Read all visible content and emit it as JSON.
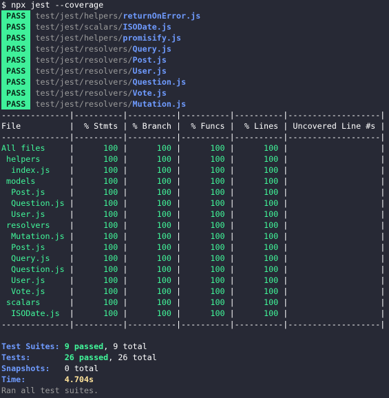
{
  "command": "$ npx jest --coverage",
  "results": [
    {
      "status": "PASS",
      "dir": "test/jest/helpers/",
      "file": "returnOnError.js"
    },
    {
      "status": "PASS",
      "dir": "test/jest/scalars/",
      "file": "ISODate.js"
    },
    {
      "status": "PASS",
      "dir": "test/jest/helpers/",
      "file": "promisify.js"
    },
    {
      "status": "PASS",
      "dir": "test/jest/resolvers/",
      "file": "Query.js"
    },
    {
      "status": "PASS",
      "dir": "test/jest/resolvers/",
      "file": "Post.js"
    },
    {
      "status": "PASS",
      "dir": "test/jest/resolvers/",
      "file": "User.js"
    },
    {
      "status": "PASS",
      "dir": "test/jest/resolvers/",
      "file": "Question.js"
    },
    {
      "status": "PASS",
      "dir": "test/jest/resolvers/",
      "file": "Vote.js"
    },
    {
      "status": "PASS",
      "dir": "test/jest/resolvers/",
      "file": "Mutation.js"
    }
  ],
  "coverage": {
    "headers": [
      "File",
      "% Stmts",
      "% Branch",
      "% Funcs",
      "% Lines",
      "Uncovered Line #s"
    ],
    "rows": [
      {
        "file": "All files",
        "indent": 0,
        "stmts": "100",
        "branch": "100",
        "funcs": "100",
        "lines": "100",
        "uncovered": ""
      },
      {
        "file": "helpers",
        "indent": 1,
        "stmts": "100",
        "branch": "100",
        "funcs": "100",
        "lines": "100",
        "uncovered": ""
      },
      {
        "file": "index.js",
        "indent": 2,
        "stmts": "100",
        "branch": "100",
        "funcs": "100",
        "lines": "100",
        "uncovered": ""
      },
      {
        "file": "models",
        "indent": 1,
        "stmts": "100",
        "branch": "100",
        "funcs": "100",
        "lines": "100",
        "uncovered": ""
      },
      {
        "file": "Post.js",
        "indent": 2,
        "stmts": "100",
        "branch": "100",
        "funcs": "100",
        "lines": "100",
        "uncovered": ""
      },
      {
        "file": "Question.js",
        "indent": 2,
        "stmts": "100",
        "branch": "100",
        "funcs": "100",
        "lines": "100",
        "uncovered": ""
      },
      {
        "file": "User.js",
        "indent": 2,
        "stmts": "100",
        "branch": "100",
        "funcs": "100",
        "lines": "100",
        "uncovered": ""
      },
      {
        "file": "resolvers",
        "indent": 1,
        "stmts": "100",
        "branch": "100",
        "funcs": "100",
        "lines": "100",
        "uncovered": ""
      },
      {
        "file": "Mutation.js",
        "indent": 2,
        "stmts": "100",
        "branch": "100",
        "funcs": "100",
        "lines": "100",
        "uncovered": ""
      },
      {
        "file": "Post.js",
        "indent": 2,
        "stmts": "100",
        "branch": "100",
        "funcs": "100",
        "lines": "100",
        "uncovered": ""
      },
      {
        "file": "Query.js",
        "indent": 2,
        "stmts": "100",
        "branch": "100",
        "funcs": "100",
        "lines": "100",
        "uncovered": ""
      },
      {
        "file": "Question.js",
        "indent": 2,
        "stmts": "100",
        "branch": "100",
        "funcs": "100",
        "lines": "100",
        "uncovered": ""
      },
      {
        "file": "User.js",
        "indent": 2,
        "stmts": "100",
        "branch": "100",
        "funcs": "100",
        "lines": "100",
        "uncovered": ""
      },
      {
        "file": "Vote.js",
        "indent": 2,
        "stmts": "100",
        "branch": "100",
        "funcs": "100",
        "lines": "100",
        "uncovered": ""
      },
      {
        "file": "scalars",
        "indent": 1,
        "stmts": "100",
        "branch": "100",
        "funcs": "100",
        "lines": "100",
        "uncovered": ""
      },
      {
        "file": "ISODate.js",
        "indent": 2,
        "stmts": "100",
        "branch": "100",
        "funcs": "100",
        "lines": "100",
        "uncovered": ""
      }
    ]
  },
  "summary": {
    "suites": {
      "label": "Test Suites:",
      "passed": "9 passed",
      "total": ", 9 total"
    },
    "tests": {
      "label": "Tests:",
      "passed": "26 passed",
      "total": ", 26 total"
    },
    "snapshots": {
      "label": "Snapshots:",
      "total": "0 total"
    },
    "time": {
      "label": "Time:",
      "value": "4.704s"
    },
    "footer": "Ran all test suites."
  },
  "colors": {
    "background": "#272935",
    "pass_badge": "#3ff09a",
    "covered": "#41f79a",
    "path_dim": "#9b9b9b",
    "filename": "#6f9bff",
    "time": "#ffe39a"
  }
}
